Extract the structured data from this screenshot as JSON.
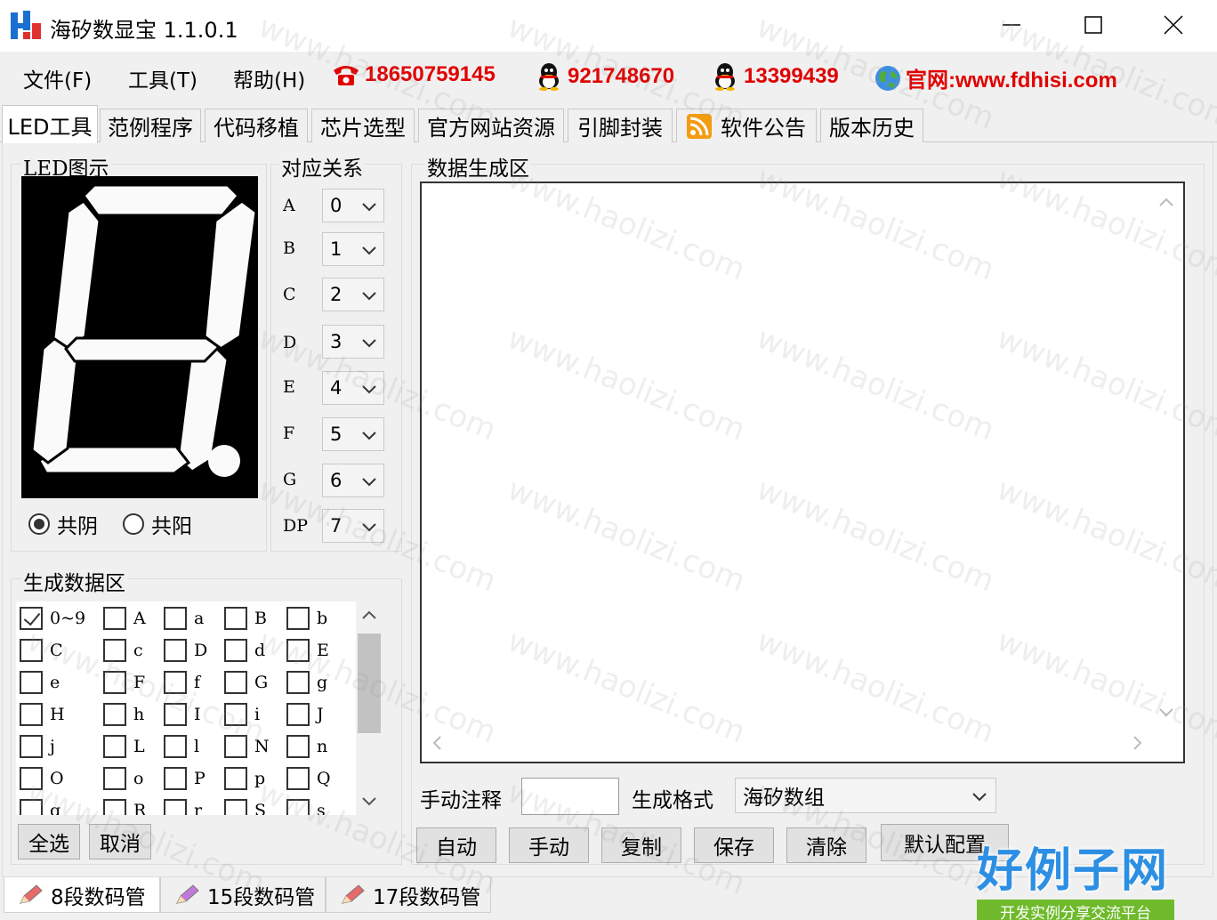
{
  "window": {
    "title": "海矽数显宝 1.1.0.1"
  },
  "menu": [
    "文件(F)",
    "工具(T)",
    "帮助(H)"
  ],
  "contacts": {
    "phone": "18650759145",
    "qq1": "921748670",
    "qq2": "13399439",
    "website": "官网:www.fdhisi.com"
  },
  "tabs": [
    "LED工具",
    "范例程序",
    "代码移植",
    "芯片选型",
    "官方网站资源",
    "引脚封装",
    "软件公告",
    "版本历史"
  ],
  "led_panel": {
    "label": "LED图示",
    "radio_common_cathode": "共阴",
    "radio_common_anode": "共阳",
    "selected_radio": "共阴"
  },
  "mapping": {
    "label": "对应关系",
    "rows": [
      {
        "seg": "A",
        "value": "0"
      },
      {
        "seg": "B",
        "value": "1"
      },
      {
        "seg": "C",
        "value": "2"
      },
      {
        "seg": "D",
        "value": "3"
      },
      {
        "seg": "E",
        "value": "4"
      },
      {
        "seg": "F",
        "value": "5"
      },
      {
        "seg": "G",
        "value": "6"
      },
      {
        "seg": "DP",
        "value": "7"
      }
    ]
  },
  "gen_area": {
    "label": "生成数据区",
    "rows": [
      [
        "0~9",
        "A",
        "a",
        "B",
        "b"
      ],
      [
        "C",
        "c",
        "D",
        "d",
        "E"
      ],
      [
        "e",
        "F",
        "f",
        "G",
        "g"
      ],
      [
        "H",
        "h",
        "I",
        "i",
        "J"
      ],
      [
        "j",
        "L",
        "l",
        "N",
        "n"
      ],
      [
        "O",
        "o",
        "P",
        "p",
        "Q"
      ],
      [
        "q",
        "R",
        "r",
        "S",
        "s"
      ]
    ],
    "checked": [
      "0~9"
    ],
    "select_all": "全选",
    "cancel": "取消"
  },
  "data_gen": {
    "label": "数据生成区",
    "manual_note_label": "手动注释",
    "manual_note_value": "",
    "format_label": "生成格式",
    "format_value": "海矽数组",
    "buttons": [
      "自动",
      "手动",
      "复制",
      "保存",
      "清除",
      "默认配置"
    ]
  },
  "bottom_tabs": [
    "8段数码管",
    "15段数码管",
    "17段数码管"
  ],
  "watermark": {
    "text": "www.haolizi.com"
  },
  "brand": {
    "title": "好例子网",
    "subtitle": "开发实例分享交流平台"
  },
  "colors": {
    "contact_red": "#e00000",
    "brand_blue": "#2c8fe3",
    "brand_green": "#6fba2c"
  }
}
